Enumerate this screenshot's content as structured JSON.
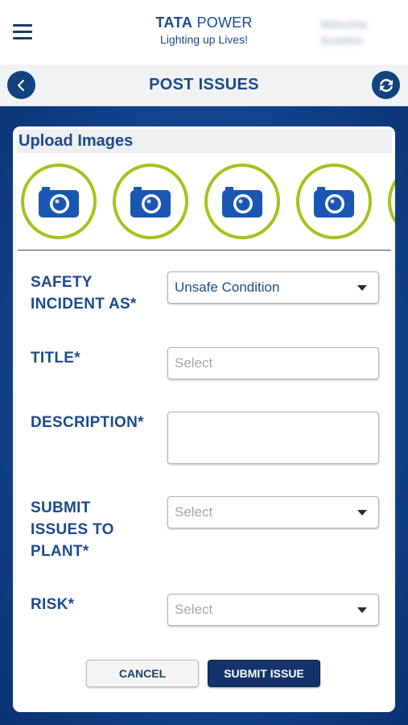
{
  "header": {
    "logo_brand": "TATA",
    "logo_word": "POWER",
    "logo_tagline": "Lighting up Lives!",
    "welcome_line1": "Welcome",
    "welcome_line2": "Surekha"
  },
  "title_bar": {
    "title": "POST ISSUES"
  },
  "upload": {
    "heading": "Upload Images",
    "slots": [
      "camera-icon",
      "camera-icon",
      "camera-icon",
      "camera-icon",
      "camera-icon"
    ]
  },
  "form": {
    "safety_incident": {
      "label": "SAFETY INCIDENT AS*",
      "value": "Unsafe Condition"
    },
    "title": {
      "label": "TITLE*",
      "placeholder": "Select"
    },
    "description": {
      "label": "DESCRIPTION*",
      "value": ""
    },
    "plant": {
      "label": "SUBMIT ISSUES TO PLANT*",
      "placeholder": "Select"
    },
    "risk": {
      "label": "RISK*",
      "placeholder": "Select"
    }
  },
  "buttons": {
    "cancel": "CANCEL",
    "submit": "SUBMIT ISSUE"
  },
  "icons": {
    "menu": "menu-icon",
    "back": "back-icon",
    "refresh": "refresh-icon",
    "dropdown": "chevron-down-icon"
  },
  "colors": {
    "brand_blue": "#1c4a8d",
    "accent_green": "#a5c31c",
    "button_navy": "#13336b"
  }
}
